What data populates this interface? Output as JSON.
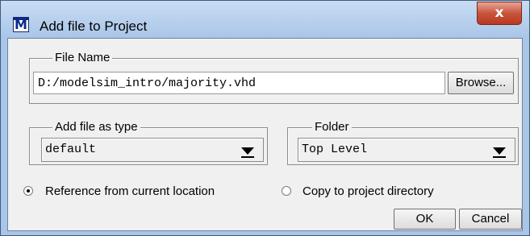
{
  "window": {
    "title": "Add file to Project",
    "app_icon": "modelsim-icon",
    "close_label": "x"
  },
  "file_name": {
    "legend": "File Name",
    "value": "D:/modelsim_intro/majority.vhd",
    "browse_label": "Browse..."
  },
  "file_type": {
    "legend": "Add file as type",
    "selected": "default"
  },
  "folder": {
    "legend": "Folder",
    "selected": "Top Level"
  },
  "location_options": [
    {
      "label": "Reference from current location",
      "checked": true
    },
    {
      "label": "Copy to project directory",
      "checked": false
    }
  ],
  "buttons": {
    "ok_label": "OK",
    "cancel_label": "Cancel"
  }
}
